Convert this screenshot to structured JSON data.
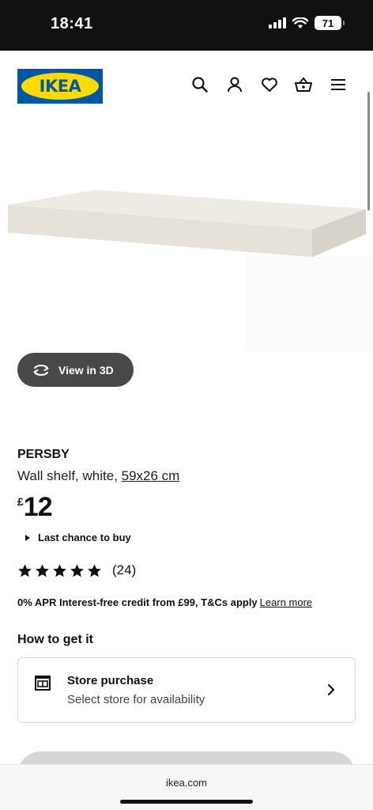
{
  "status_bar": {
    "time": "18:41",
    "battery": "71"
  },
  "header": {
    "logo_text": "IKEA",
    "icons": [
      "search-icon",
      "account-icon",
      "heart-icon",
      "basket-icon",
      "menu-icon"
    ]
  },
  "product": {
    "view3d_label": "View in 3D",
    "name": "PERSBY",
    "desc_prefix": "Wall shelf, white, ",
    "desc_size": "59x26 cm",
    "price_currency": "£",
    "price_amount": "12",
    "last_chance": "Last chance to buy",
    "rating_stars": 5,
    "rating_count": "(24)",
    "credit_text": "0% APR Interest-free credit from £99, T&Cs apply",
    "credit_link": "Learn more"
  },
  "delivery": {
    "heading": "How to get it",
    "store_title": "Store purchase",
    "store_sub": "Select store for availability"
  },
  "browser": {
    "domain": "ikea.com"
  },
  "colors": {
    "brand_blue": "#0058a3",
    "brand_yellow": "#ffdb00",
    "button_dark": "#484848"
  }
}
